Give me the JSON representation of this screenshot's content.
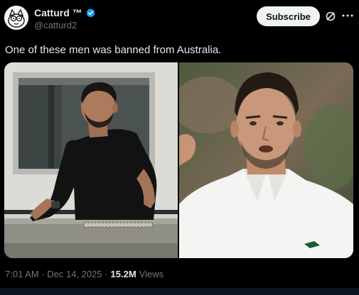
{
  "post": {
    "author": {
      "display_name": "Catturd ™",
      "handle": "@catturd2",
      "verified": true,
      "verified_color": "#1d9bf0"
    },
    "subscribe_label": "Subscribe",
    "text": "One of these men was banned from Australia.",
    "timestamp": "7:01 AM · Dec 14, 2025 · ",
    "views_count": "15.2M",
    "views_label": "Views"
  },
  "icons": {
    "verified": "verified-badge-icon",
    "grok": "grok-icon",
    "more": "more-options-icon"
  },
  "colors": {
    "background": "#000000",
    "text_primary": "#e7e9ea",
    "text_secondary": "#71767b",
    "button_bg": "#eff3f4"
  }
}
